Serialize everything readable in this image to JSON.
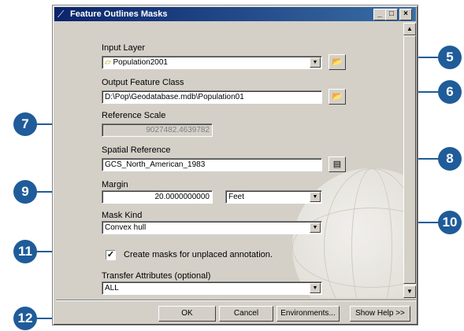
{
  "window": {
    "title": "Feature Outlines Masks",
    "controls": {
      "minimize": "_",
      "maximize": "□",
      "close": "×"
    }
  },
  "form": {
    "input_layer": {
      "label": "Input Layer",
      "value": "Population2001"
    },
    "output_feature_class": {
      "label": "Output Feature Class",
      "value": "D:\\Pop\\Geodatabase.mdb\\Population01"
    },
    "reference_scale": {
      "label": "Reference Scale",
      "value": "9027482.4639782"
    },
    "spatial_reference": {
      "label": "Spatial Reference",
      "value": "GCS_North_American_1983"
    },
    "margin": {
      "label": "Margin",
      "value": "20.0000000000",
      "unit": "Feet"
    },
    "mask_kind": {
      "label": "Mask Kind",
      "value": "Convex hull"
    },
    "unplaced_annotation": {
      "label": "Create masks for unplaced annotation.",
      "checked": true
    },
    "transfer_attributes": {
      "label": "Transfer Attributes (optional)",
      "value": "ALL"
    }
  },
  "buttons": {
    "ok": "OK",
    "cancel": "Cancel",
    "environments": "Environments...",
    "show_help": "Show Help >>"
  },
  "callouts": [
    "5",
    "6",
    "7",
    "8",
    "9",
    "10",
    "11",
    "12"
  ],
  "colors": {
    "callout": "#1f5c99",
    "title_bar_start": "#0a246a",
    "title_bar_end": "#3a6ea5",
    "dialog_bg": "#d4d0c8"
  }
}
